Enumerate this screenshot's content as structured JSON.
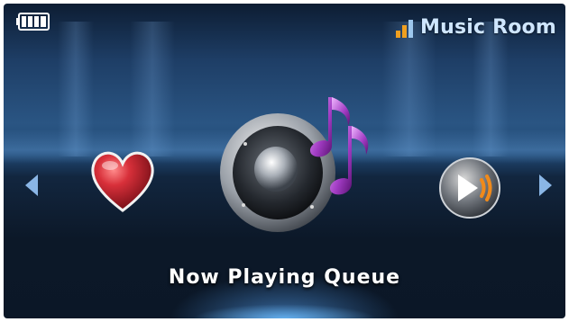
{
  "status_bar": {
    "battery_icon": "battery-full-icon",
    "signal_icon": "signal-bars-icon",
    "room_name": "Music Room"
  },
  "carousel": {
    "left_arrow_icon": "arrow-left-icon",
    "right_arrow_icon": "arrow-right-icon",
    "items": [
      {
        "icon": "heart-icon"
      },
      {
        "icon": "speaker-music-notes-icon"
      },
      {
        "icon": "play-forward-icon"
      }
    ],
    "selected_label": "Now Playing Queue"
  },
  "colors": {
    "accent_blue": "#cfe6ff",
    "signal_orange": "#f0a020",
    "heart_red": "#c0202a",
    "note_purple": "#a23cc4"
  }
}
